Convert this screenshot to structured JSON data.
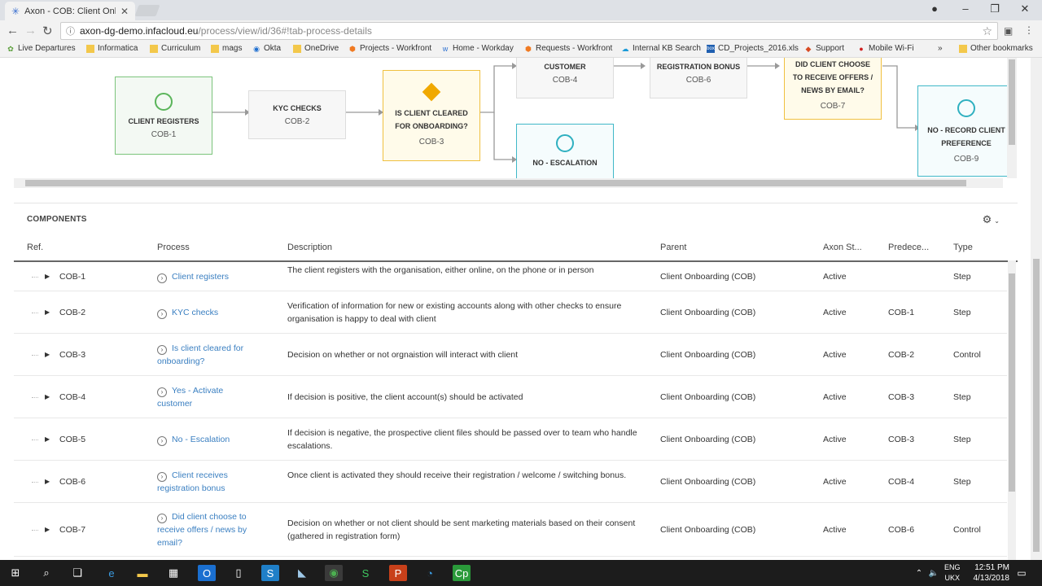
{
  "browser": {
    "tab_title": "Axon - COB: Client Onbo",
    "url_host": "axon-dg-demo.infacloud.eu",
    "url_path": "/process/view/id/36#!tab-process-details",
    "bookmarks": [
      "Live Departures",
      "Informatica",
      "Curriculum",
      "mags",
      "Okta",
      "OneDrive",
      "Projects - Workfront",
      "Home - Workday",
      "Requests - Workfront",
      "Internal KB Search",
      "CD_Projects_2016.xls",
      "Support",
      "Mobile Wi-Fi",
      "Other bookmarks"
    ]
  },
  "diagram": {
    "nodes": [
      {
        "label": "CLIENT REGISTERS",
        "ref": "COB-1"
      },
      {
        "label": "KYC CHECKS",
        "ref": "COB-2"
      },
      {
        "label": "IS CLIENT CLEARED FOR ONBOARDING?",
        "ref": "COB-3"
      },
      {
        "label": "CUSTOMER",
        "ref": "COB-4"
      },
      {
        "label": "NO - ESCALATION",
        "ref": ""
      },
      {
        "label": "REGISTRATION BONUS",
        "ref": "COB-6"
      },
      {
        "label": "DID CLIENT CHOOSE TO RECEIVE OFFERS / NEWS BY EMAIL?",
        "ref": "COB-7"
      },
      {
        "label": "NO - RECORD CLIENT PREFERENCE",
        "ref": "COB-9"
      }
    ]
  },
  "components": {
    "title": "COMPONENTS",
    "columns": [
      "Ref.",
      "Process",
      "Description",
      "Parent",
      "Axon St...",
      "Predece...",
      "Type"
    ],
    "rows": [
      {
        "ref": "COB-1",
        "process": "Client registers",
        "description": "The client registers with the organisation, either online, on the phone or in person",
        "parent": "Client Onboarding (COB)",
        "status": "Active",
        "pred": "",
        "type": "Step"
      },
      {
        "ref": "COB-2",
        "process": "KYC checks",
        "description": "Verification of information for new or existing accounts along with other checks to ensure organisation is happy to deal with client",
        "parent": "Client Onboarding (COB)",
        "status": "Active",
        "pred": "COB-1",
        "type": "Step"
      },
      {
        "ref": "COB-3",
        "process": "Is client cleared for onboarding?",
        "description": "Decision on whether or not orgnaistion will interact with client",
        "parent": "Client Onboarding (COB)",
        "status": "Active",
        "pred": "COB-2",
        "type": "Control"
      },
      {
        "ref": "COB-4",
        "process": "Yes - Activate customer",
        "description": "If decision is positive, the client account(s) should be activated",
        "parent": "Client Onboarding (COB)",
        "status": "Active",
        "pred": "COB-3",
        "type": "Step"
      },
      {
        "ref": "COB-5",
        "process": "No - Escalation",
        "description": "If decision is negative, the prospective client files should be passed over to team who handle escalations.",
        "parent": "Client Onboarding (COB)",
        "status": "Active",
        "pred": "COB-3",
        "type": "Step"
      },
      {
        "ref": "COB-6",
        "process": "Client receives registration bonus",
        "description": "Once client is activated they should receive their registration / welcome / switching bonus.",
        "parent": "Client Onboarding (COB)",
        "status": "Active",
        "pred": "COB-4",
        "type": "Step"
      },
      {
        "ref": "COB-7",
        "process": "Did client choose to receive offers / news by email?",
        "description": "Decision on whether or not client should be sent marketing materials based on their consent (gathered in registration form)",
        "parent": "Client Onboarding (COB)",
        "status": "Active",
        "pred": "COB-6",
        "type": "Control"
      }
    ]
  },
  "taskbar": {
    "lang1": "ENG",
    "lang2": "UKX",
    "time": "12:51 PM",
    "date": "4/13/2018"
  }
}
